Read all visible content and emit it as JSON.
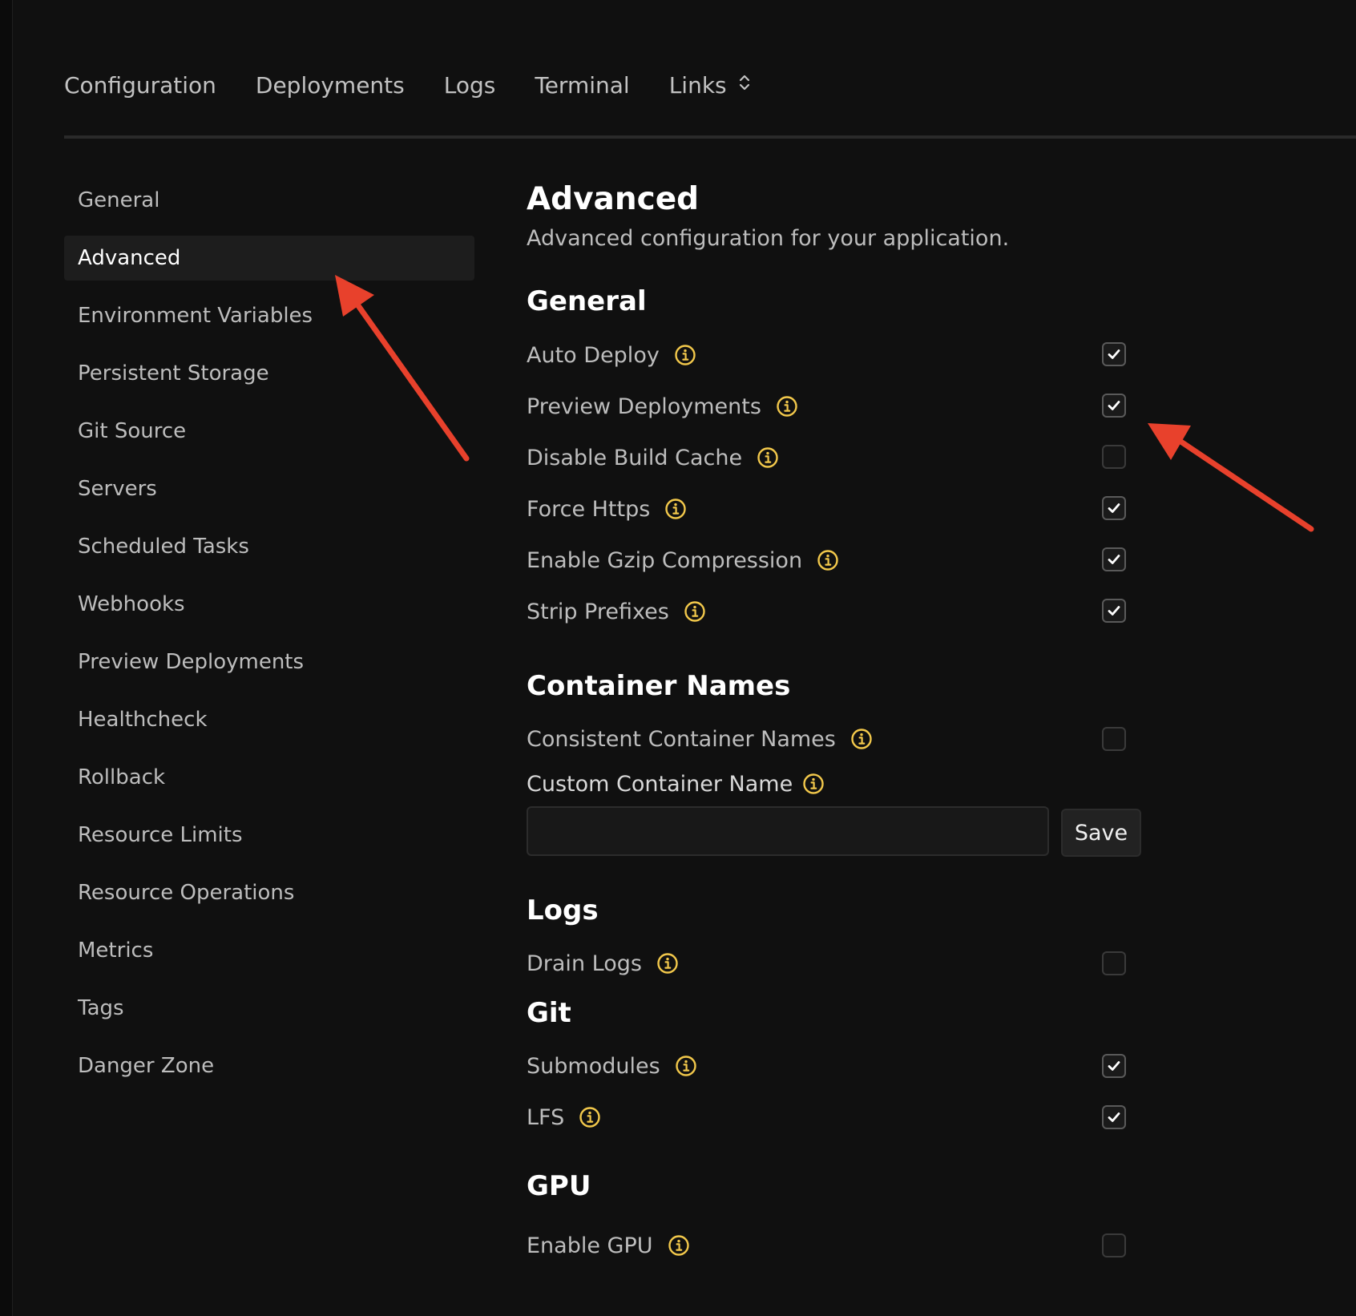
{
  "colors": {
    "background": "#101010",
    "info_icon": "#f2c84b",
    "annotation_arrow": "#e8412c",
    "active_item_bg": "#1d1d1d"
  },
  "tabs": [
    {
      "label": "Configuration"
    },
    {
      "label": "Deployments"
    },
    {
      "label": "Logs"
    },
    {
      "label": "Terminal"
    },
    {
      "label": "Links",
      "icon": "chevron-up-down-icon"
    }
  ],
  "sidebar": {
    "active": "Advanced",
    "items": [
      {
        "label": "General"
      },
      {
        "label": "Advanced"
      },
      {
        "label": "Environment Variables"
      },
      {
        "label": "Persistent Storage"
      },
      {
        "label": "Git Source"
      },
      {
        "label": "Servers"
      },
      {
        "label": "Scheduled Tasks"
      },
      {
        "label": "Webhooks"
      },
      {
        "label": "Preview Deployments"
      },
      {
        "label": "Healthcheck"
      },
      {
        "label": "Rollback"
      },
      {
        "label": "Resource Limits"
      },
      {
        "label": "Resource Operations"
      },
      {
        "label": "Metrics"
      },
      {
        "label": "Tags"
      },
      {
        "label": "Danger Zone"
      }
    ]
  },
  "main": {
    "title": "Advanced",
    "subtitle": "Advanced configuration for your application.",
    "sections": {
      "general": {
        "title": "General",
        "options": [
          {
            "label": "Auto Deploy",
            "checked": true
          },
          {
            "label": "Preview Deployments",
            "checked": true
          },
          {
            "label": "Disable Build Cache",
            "checked": false
          },
          {
            "label": "Force Https",
            "checked": true
          },
          {
            "label": "Enable Gzip Compression",
            "checked": true
          },
          {
            "label": "Strip Prefixes",
            "checked": true
          }
        ]
      },
      "container_names": {
        "title": "Container Names",
        "options": [
          {
            "label": "Consistent Container Names",
            "checked": false
          }
        ],
        "custom_field": {
          "label": "Custom Container Name",
          "value": "",
          "placeholder": "",
          "save_label": "Save"
        }
      },
      "logs": {
        "title": "Logs",
        "options": [
          {
            "label": "Drain Logs",
            "checked": false
          }
        ]
      },
      "git": {
        "title": "Git",
        "options": [
          {
            "label": "Submodules",
            "checked": true
          },
          {
            "label": "LFS",
            "checked": true
          }
        ]
      },
      "gpu": {
        "title": "GPU",
        "options": [
          {
            "label": "Enable GPU",
            "checked": false
          }
        ]
      }
    }
  }
}
